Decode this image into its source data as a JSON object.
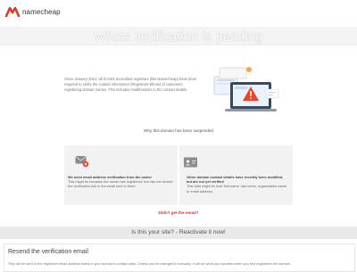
{
  "header": {
    "logo_text": "namecheap",
    "logo_icon": "namecheap-n-logo",
    "brand_color": "#de3723"
  },
  "hero": {
    "title": "Whois verification is pending"
  },
  "intro": {
    "text": "Since January 2014, all ICANN accredited registrars (like Namecheap) have been required to verify the contact information (Registrant Whois) of customers registering domain names. This includes modifications to the contact details."
  },
  "illustration": {
    "icon": "laptop-warning-icon",
    "warning_color": "#e8452c"
  },
  "suspended": {
    "label": "Why this domain has been suspended"
  },
  "cards": [
    {
      "icon": "email-error-icon",
      "title": "We need email address verification from the owner",
      "body": "This might be because the owner has registered, but has not clicked the verification link in the email sent to them."
    },
    {
      "icon": "id-card-icon",
      "title": "Other domain contact details have recently been modified, but are not yet verified",
      "body": "This data might be their first name, last name, organization name or email address."
    }
  ],
  "help": {
    "link": "Didn't get the email?"
  },
  "reactivate": {
    "text": "Is this your site? - Reactivate it now!"
  },
  "resend": {
    "title": "Resend the verification email",
    "description": "This will be sent to the registrant email address listed in your domain's contact data. Unless you've changed it manually, it will be what you inputted when you first registered the domain."
  }
}
